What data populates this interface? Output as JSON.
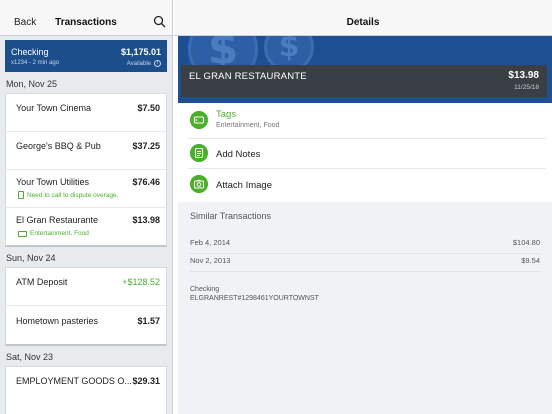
{
  "left": {
    "back_label": "Back",
    "title": "Transactions",
    "account": {
      "name": "Checking",
      "balance": "$1,175.01",
      "subtitle": "x1234 - 2 min ago",
      "available_label": "Available"
    },
    "groups": [
      {
        "date": "Mon, Nov 25",
        "items": [
          {
            "name": "Your Town Cinema",
            "amount": "$7.50"
          },
          {
            "name": "George's BBQ & Pub",
            "amount": "$37.25"
          },
          {
            "name": "Your Town Utilities",
            "amount": "$76.46",
            "note": "Need to call to dispute overage."
          },
          {
            "name": "El Gran Restaurante",
            "amount": "$13.98",
            "tags": "Entertainment, Food"
          }
        ]
      },
      {
        "date": "Sun, Nov 24",
        "items": [
          {
            "name": "ATM Deposit",
            "amount": "+$128.52"
          },
          {
            "name": "Hometown pasteries",
            "amount": "$1.57"
          }
        ]
      },
      {
        "date": "Sat, Nov 23",
        "items": [
          {
            "name": "EMPLOYMENT GOODS O...",
            "amount": "$29.31"
          }
        ]
      }
    ]
  },
  "right": {
    "title": "Details",
    "transaction": {
      "name": "EL GRAN RESTAURANTE",
      "amount": "$13.98",
      "date": "11/25/18"
    },
    "actions": {
      "tags_label": "Tags",
      "tags_value": "Entertainment, Food",
      "notes_label": "Add Notes",
      "image_label": "Attach Image"
    },
    "similar": {
      "title": "Similar Transactions",
      "rows": [
        {
          "date": "Feb 4, 2014",
          "amount": "$104.80"
        },
        {
          "date": "Nov 2, 2013",
          "amount": "$9.54"
        }
      ],
      "account_label": "Checking",
      "account_detail": "ELGRANREST#1298461YOURTOWNST"
    }
  },
  "colors": {
    "accent_green": "#4caf2c",
    "account_blue": "#1b4e8a",
    "banner_blue": "#1e4f93",
    "tx_bar": "#3a3f46"
  },
  "icons": [
    "search-icon",
    "info-icon",
    "note-icon",
    "tag-icon",
    "notes-icon",
    "camera-icon",
    "dollar-coin-icon"
  ]
}
